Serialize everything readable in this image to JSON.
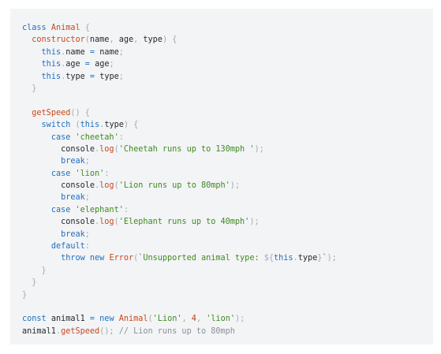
{
  "colors": {
    "background": "#ffffff",
    "panel": "#f3f4f6",
    "keyword": "#1f6fbf",
    "function_name": "#c8481b",
    "string": "#3f8a1f",
    "number": "#b8431a",
    "punctuation": "#a4a9b1",
    "comment": "#8a8f98",
    "identifier": "#24292e"
  },
  "code": {
    "language": "javascript",
    "lines": [
      [
        [
          "kw",
          "class"
        ],
        [
          "ws",
          " "
        ],
        [
          "fn",
          "Animal"
        ],
        [
          "ws",
          " "
        ],
        [
          "pun",
          "{"
        ]
      ],
      [
        [
          "ws",
          "  "
        ],
        [
          "fn",
          "constructor"
        ],
        [
          "pun",
          "("
        ],
        [
          "id",
          "name"
        ],
        [
          "pun",
          ","
        ],
        [
          "ws",
          " "
        ],
        [
          "id",
          "age"
        ],
        [
          "pun",
          ","
        ],
        [
          "ws",
          " "
        ],
        [
          "id",
          "type"
        ],
        [
          "pun",
          ")"
        ],
        [
          "ws",
          " "
        ],
        [
          "pun",
          "{"
        ]
      ],
      [
        [
          "ws",
          "    "
        ],
        [
          "kw",
          "this"
        ],
        [
          "pun",
          "."
        ],
        [
          "id",
          "name"
        ],
        [
          "ws",
          " "
        ],
        [
          "kw",
          "="
        ],
        [
          "ws",
          " "
        ],
        [
          "id",
          "name"
        ],
        [
          "pun",
          ";"
        ]
      ],
      [
        [
          "ws",
          "    "
        ],
        [
          "kw",
          "this"
        ],
        [
          "pun",
          "."
        ],
        [
          "id",
          "age"
        ],
        [
          "ws",
          " "
        ],
        [
          "kw",
          "="
        ],
        [
          "ws",
          " "
        ],
        [
          "id",
          "age"
        ],
        [
          "pun",
          ";"
        ]
      ],
      [
        [
          "ws",
          "    "
        ],
        [
          "kw",
          "this"
        ],
        [
          "pun",
          "."
        ],
        [
          "id",
          "type"
        ],
        [
          "ws",
          " "
        ],
        [
          "kw",
          "="
        ],
        [
          "ws",
          " "
        ],
        [
          "id",
          "type"
        ],
        [
          "pun",
          ";"
        ]
      ],
      [
        [
          "ws",
          "  "
        ],
        [
          "pun",
          "}"
        ]
      ],
      [],
      [
        [
          "ws",
          "  "
        ],
        [
          "fn",
          "getSpeed"
        ],
        [
          "pun",
          "()"
        ],
        [
          "ws",
          " "
        ],
        [
          "pun",
          "{"
        ]
      ],
      [
        [
          "ws",
          "    "
        ],
        [
          "kw",
          "switch"
        ],
        [
          "ws",
          " "
        ],
        [
          "pun",
          "("
        ],
        [
          "kw",
          "this"
        ],
        [
          "pun",
          "."
        ],
        [
          "id",
          "type"
        ],
        [
          "pun",
          ")"
        ],
        [
          "ws",
          " "
        ],
        [
          "pun",
          "{"
        ]
      ],
      [
        [
          "ws",
          "      "
        ],
        [
          "kw",
          "case"
        ],
        [
          "ws",
          " "
        ],
        [
          "str",
          "'cheetah'"
        ],
        [
          "pun",
          ":"
        ]
      ],
      [
        [
          "ws",
          "        "
        ],
        [
          "id",
          "console"
        ],
        [
          "pun",
          "."
        ],
        [
          "fn",
          "log"
        ],
        [
          "pun",
          "("
        ],
        [
          "str",
          "'Cheetah runs up to 130mph '"
        ],
        [
          "pun",
          ");"
        ]
      ],
      [
        [
          "ws",
          "        "
        ],
        [
          "kw",
          "break"
        ],
        [
          "pun",
          ";"
        ]
      ],
      [
        [
          "ws",
          "      "
        ],
        [
          "kw",
          "case"
        ],
        [
          "ws",
          " "
        ],
        [
          "str",
          "'lion'"
        ],
        [
          "pun",
          ":"
        ]
      ],
      [
        [
          "ws",
          "        "
        ],
        [
          "id",
          "console"
        ],
        [
          "pun",
          "."
        ],
        [
          "fn",
          "log"
        ],
        [
          "pun",
          "("
        ],
        [
          "str",
          "'Lion runs up to 80mph'"
        ],
        [
          "pun",
          ");"
        ]
      ],
      [
        [
          "ws",
          "        "
        ],
        [
          "kw",
          "break"
        ],
        [
          "pun",
          ";"
        ]
      ],
      [
        [
          "ws",
          "      "
        ],
        [
          "kw",
          "case"
        ],
        [
          "ws",
          " "
        ],
        [
          "str",
          "'elephant'"
        ],
        [
          "pun",
          ":"
        ]
      ],
      [
        [
          "ws",
          "        "
        ],
        [
          "id",
          "console"
        ],
        [
          "pun",
          "."
        ],
        [
          "fn",
          "log"
        ],
        [
          "pun",
          "("
        ],
        [
          "str",
          "'Elephant runs up to 40mph'"
        ],
        [
          "pun",
          ");"
        ]
      ],
      [
        [
          "ws",
          "        "
        ],
        [
          "kw",
          "break"
        ],
        [
          "pun",
          ";"
        ]
      ],
      [
        [
          "ws",
          "      "
        ],
        [
          "kw",
          "default"
        ],
        [
          "pun",
          ":"
        ]
      ],
      [
        [
          "ws",
          "        "
        ],
        [
          "kw",
          "throw"
        ],
        [
          "ws",
          " "
        ],
        [
          "kw",
          "new"
        ],
        [
          "ws",
          " "
        ],
        [
          "fn",
          "Error"
        ],
        [
          "pun",
          "("
        ],
        [
          "str",
          "`Unsupported animal type: "
        ],
        [
          "pun",
          "${"
        ],
        [
          "kw",
          "this"
        ],
        [
          "pun",
          "."
        ],
        [
          "id",
          "type"
        ],
        [
          "pun",
          "}"
        ],
        [
          "str",
          "`"
        ],
        [
          "pun",
          ");"
        ]
      ],
      [
        [
          "ws",
          "    "
        ],
        [
          "pun",
          "}"
        ]
      ],
      [
        [
          "ws",
          "  "
        ],
        [
          "pun",
          "}"
        ]
      ],
      [
        [
          "pun",
          "}"
        ]
      ],
      [],
      [
        [
          "kw",
          "const"
        ],
        [
          "ws",
          " "
        ],
        [
          "id",
          "animal1"
        ],
        [
          "ws",
          " "
        ],
        [
          "kw",
          "="
        ],
        [
          "ws",
          " "
        ],
        [
          "kw",
          "new"
        ],
        [
          "ws",
          " "
        ],
        [
          "fn",
          "Animal"
        ],
        [
          "pun",
          "("
        ],
        [
          "str",
          "'Lion'"
        ],
        [
          "pun",
          ","
        ],
        [
          "ws",
          " "
        ],
        [
          "num",
          "4"
        ],
        [
          "pun",
          ","
        ],
        [
          "ws",
          " "
        ],
        [
          "str",
          "'lion'"
        ],
        [
          "pun",
          ");"
        ]
      ],
      [
        [
          "id",
          "animal1"
        ],
        [
          "pun",
          "."
        ],
        [
          "fn",
          "getSpeed"
        ],
        [
          "pun",
          "();"
        ],
        [
          "ws",
          " "
        ],
        [
          "cm",
          "// Lion runs up to 80mph"
        ]
      ]
    ]
  }
}
